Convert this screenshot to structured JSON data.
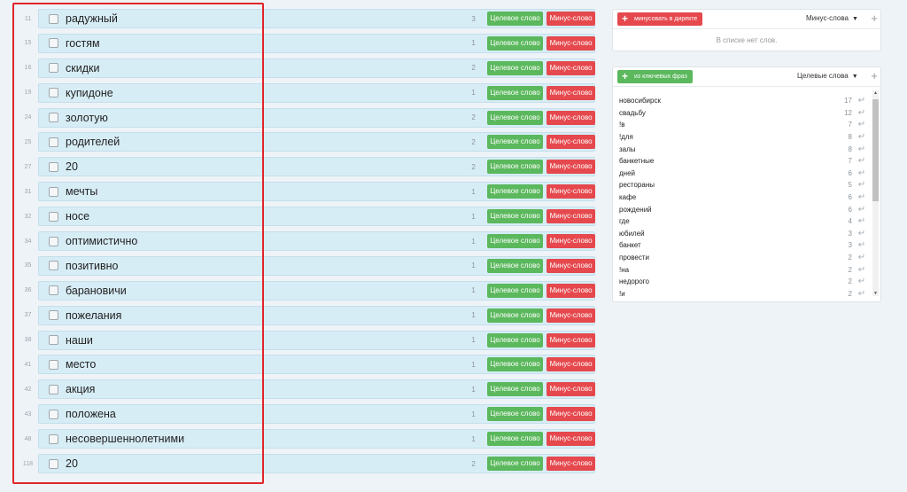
{
  "buttons": {
    "target": "Целевое слово",
    "minus": "Минус-слово"
  },
  "words": [
    {
      "num": "11",
      "word": "радужный",
      "count": "3"
    },
    {
      "num": "15",
      "word": "гостям",
      "count": "1"
    },
    {
      "num": "16",
      "word": "скидки",
      "count": "2"
    },
    {
      "num": "19",
      "word": "купидоне",
      "count": "1"
    },
    {
      "num": "24",
      "word": "золотую",
      "count": "2"
    },
    {
      "num": "25",
      "word": "родителей",
      "count": "2"
    },
    {
      "num": "27",
      "word": "20",
      "count": "2"
    },
    {
      "num": "31",
      "word": "мечты",
      "count": "1"
    },
    {
      "num": "32",
      "word": "носе",
      "count": "1"
    },
    {
      "num": "34",
      "word": "оптимистично",
      "count": "1"
    },
    {
      "num": "35",
      "word": "позитивно",
      "count": "1"
    },
    {
      "num": "36",
      "word": "барановичи",
      "count": "1"
    },
    {
      "num": "37",
      "word": "пожелания",
      "count": "1"
    },
    {
      "num": "38",
      "word": "наши",
      "count": "1"
    },
    {
      "num": "41",
      "word": "место",
      "count": "1"
    },
    {
      "num": "42",
      "word": "акция",
      "count": "1"
    },
    {
      "num": "43",
      "word": "положена",
      "count": "1"
    },
    {
      "num": "48",
      "word": "несовершеннолетними",
      "count": "1"
    },
    {
      "num": "118",
      "word": "20",
      "count": "2"
    }
  ],
  "minus_panel": {
    "button": "минусовать в директе",
    "select": "Минус-слова",
    "empty": "В списке нет слов."
  },
  "target_panel": {
    "button": "из ключевых фраз",
    "select": "Целевые слова",
    "items": [
      {
        "word": "новосибирск",
        "count": "17"
      },
      {
        "word": "свадьбу",
        "count": "12"
      },
      {
        "word": "!в",
        "count": "7"
      },
      {
        "word": "!для",
        "count": "8"
      },
      {
        "word": "залы",
        "count": "8"
      },
      {
        "word": "банкетные",
        "count": "7"
      },
      {
        "word": "дней",
        "count": "6"
      },
      {
        "word": "рестораны",
        "count": "5"
      },
      {
        "word": "кафе",
        "count": "6"
      },
      {
        "word": "рождений",
        "count": "6"
      },
      {
        "word": "где",
        "count": "4"
      },
      {
        "word": "юбилей",
        "count": "3"
      },
      {
        "word": "банкет",
        "count": "3"
      },
      {
        "word": "провести",
        "count": "2"
      },
      {
        "word": "!на",
        "count": "2"
      },
      {
        "word": "недорого",
        "count": "2"
      },
      {
        "word": "!и",
        "count": "2"
      }
    ]
  }
}
